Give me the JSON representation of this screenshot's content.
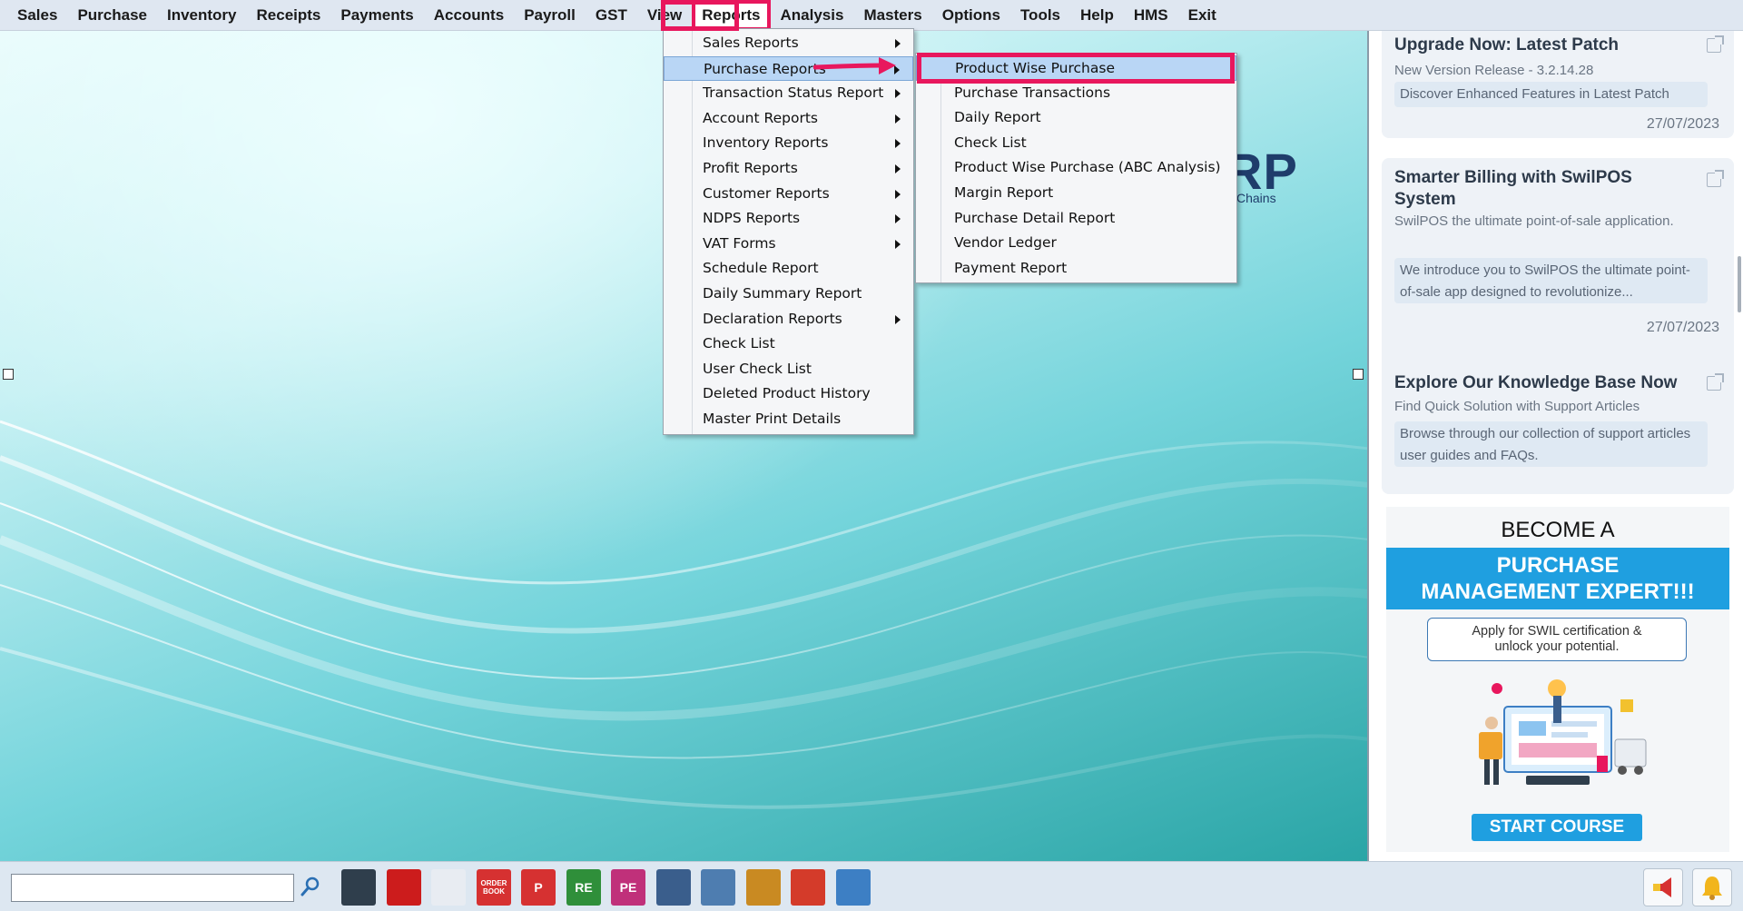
{
  "menubar": {
    "items": [
      "Sales",
      "Purchase",
      "Inventory",
      "Receipts",
      "Payments",
      "Accounts",
      "Payroll",
      "GST",
      "View",
      "Reports",
      "Analysis",
      "Masters",
      "Options",
      "Tools",
      "Help",
      "HMS",
      "Exit"
    ],
    "active": "Reports"
  },
  "logo": {
    "fragment": "RP",
    "sub": "Chains"
  },
  "reports_menu": {
    "items": [
      {
        "label": "Sales Reports",
        "submenu": true
      },
      {
        "label": "Purchase Reports",
        "submenu": true
      },
      {
        "label": "Transaction Status Report",
        "submenu": true
      },
      {
        "label": "Account Reports",
        "submenu": true
      },
      {
        "label": "Inventory Reports",
        "submenu": true
      },
      {
        "label": "Profit Reports",
        "submenu": true
      },
      {
        "label": "Customer Reports",
        "submenu": true
      },
      {
        "label": "NDPS Reports",
        "submenu": true
      },
      {
        "label": "VAT Forms",
        "submenu": true
      },
      {
        "label": "Schedule Report",
        "submenu": false
      },
      {
        "label": "Daily Summary Report",
        "submenu": false
      },
      {
        "label": "Declaration Reports",
        "submenu": true
      },
      {
        "label": "Check List",
        "submenu": false
      },
      {
        "label": "User Check List",
        "submenu": false
      },
      {
        "label": "Deleted Product History",
        "submenu": false
      },
      {
        "label": "Master Print Details",
        "submenu": false
      }
    ],
    "highlighted": "Purchase Reports"
  },
  "purchase_submenu": {
    "items": [
      "Product Wise Purchase",
      "Purchase Transactions",
      "Daily Report",
      "Check List",
      "Product Wise Purchase (ABC Analysis)",
      "Margin Report",
      "Purchase Detail Report",
      "Vendor Ledger",
      "Payment Report"
    ],
    "highlighted": "Product Wise Purchase"
  },
  "news_cards": [
    {
      "title": "Upgrade Now: Latest Patch",
      "subtitle": "New Version Release - 3.2.14.28",
      "description": "Discover Enhanced Features in Latest Patch",
      "date": "27/07/2023"
    },
    {
      "title": "Smarter Billing with SwilPOS System",
      "subtitle": "SwilPOS the ultimate point-of-sale application.",
      "description": "We introduce you to SwilPOS the ultimate point-of-sale app designed to revolutionize...",
      "date": "27/07/2023"
    },
    {
      "title": "Explore Our Knowledge Base Now",
      "subtitle": "Find Quick Solution with Support Articles",
      "description": "Browse through our collection of support articles user guides and FAQs.",
      "date": ""
    }
  ],
  "promo": {
    "become": "BECOME A",
    "headline_1": "PURCHASE",
    "headline_2": "MANAGEMENT EXPERT!!!",
    "apply_1": "Apply for SWIL certification &",
    "apply_2": "unlock your potential.",
    "cta": "START COURSE"
  },
  "toolbar": {
    "search_placeholder": "",
    "icons": [
      {
        "name": "sales-register-icon",
        "label": "",
        "color": "#2f3e4c"
      },
      {
        "name": "sales-entry-icon",
        "label": "",
        "color": "#cc1c1c"
      },
      {
        "name": "purchase-entry-icon",
        "label": "",
        "color": "#e8ecf2"
      },
      {
        "name": "order-book-icon",
        "label": "ORDER BOOK",
        "color": "#d63131"
      },
      {
        "name": "purchase-return-icon",
        "label": "P",
        "color": "#d63131"
      },
      {
        "name": "receipt-entry-icon",
        "label": "RE",
        "color": "#2f8f3a"
      },
      {
        "name": "payment-entry-icon",
        "label": "PE",
        "color": "#c0307a"
      },
      {
        "name": "stock-icon",
        "label": "",
        "color": "#3a5e8c"
      },
      {
        "name": "transfer-icon",
        "label": "",
        "color": "#4e7db0"
      },
      {
        "name": "money-bag-icon",
        "label": "",
        "color": "#c98a22"
      },
      {
        "name": "exchange-icon",
        "label": "",
        "color": "#d43b2a"
      },
      {
        "name": "printer-icon",
        "label": "",
        "color": "#3d7fc4"
      }
    ]
  },
  "colors": {
    "highlight_box": "#e8175d",
    "menu_highlight": "#b9d6f5",
    "promo_blue": "#1f9fe0"
  }
}
